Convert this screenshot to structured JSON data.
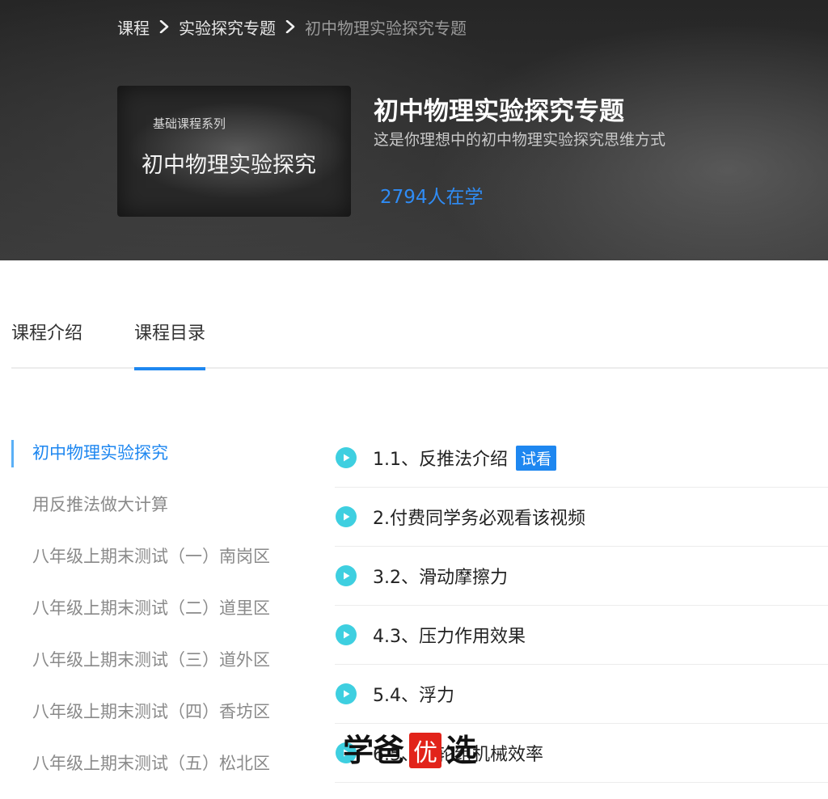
{
  "breadcrumb": {
    "items": [
      "课程",
      "实验探究专题",
      "初中物理实验探究专题"
    ]
  },
  "course": {
    "cover_series": "基础课程系列",
    "cover_title": "初中物理实验探究",
    "title": "初中物理实验探究专题",
    "subtitle": "这是你理想中的初中物理实验探究思维方式",
    "learners": "2794人在学"
  },
  "tabs": {
    "intro": "课程介绍",
    "catalog": "课程目录",
    "active": "catalog"
  },
  "chapters": [
    {
      "label": "初中物理实验探究",
      "active": true
    },
    {
      "label": "用反推法做大计算",
      "active": false
    },
    {
      "label": "八年级上期末测试（一）南岗区",
      "active": false
    },
    {
      "label": "八年级上期末测试（二）道里区",
      "active": false
    },
    {
      "label": "八年级上期末测试（三）道外区",
      "active": false
    },
    {
      "label": "八年级上期末测试（四）香坊区",
      "active": false
    },
    {
      "label": "八年级上期末测试（五）松北区",
      "active": false
    }
  ],
  "lessons": [
    {
      "title": "1.1、反推法介绍",
      "badge": "试看"
    },
    {
      "title": "2.付费同学务必观看该视频",
      "badge": ""
    },
    {
      "title": "3.2、滑动摩擦力",
      "badge": ""
    },
    {
      "title": "4.3、压力作用效果",
      "badge": ""
    },
    {
      "title": "5.4、浮力",
      "badge": ""
    },
    {
      "title": "6.5、滑轮组机械效率",
      "badge": ""
    }
  ],
  "watermark": {
    "text": "学爸优选"
  },
  "icons": {
    "breadcrumb_separator": "chevron-right-icon",
    "lesson_play": "play-circle-icon"
  },
  "colors": {
    "accent": "#1e87f0",
    "play": "#3ecfe0",
    "hero_bg": "#2c2c2c"
  }
}
